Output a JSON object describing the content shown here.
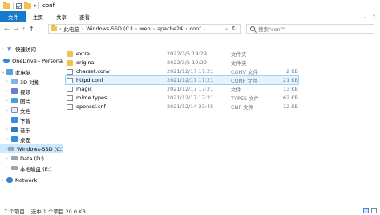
{
  "window": {
    "title": "conf"
  },
  "ribbon": {
    "tabs": [
      "文件",
      "主页",
      "共享",
      "查看"
    ]
  },
  "address": {
    "crumbs": [
      "此电脑",
      "Windows-SSD (C:)",
      "web",
      "apache24",
      "conf"
    ]
  },
  "search": {
    "placeholder": "搜索\"conf\""
  },
  "sidebar": {
    "items": [
      {
        "label": "快速访问",
        "icon": "star-icon"
      },
      {
        "label": "OneDrive - Persona",
        "icon": "cloud-icon"
      },
      {
        "label": "此电脑",
        "icon": "computer-icon"
      },
      {
        "label": "3D 对象",
        "icon": "cube-icon"
      },
      {
        "label": "视频",
        "icon": "video-icon"
      },
      {
        "label": "图片",
        "icon": "picture-icon"
      },
      {
        "label": "文档",
        "icon": "document-icon"
      },
      {
        "label": "下载",
        "icon": "download-icon"
      },
      {
        "label": "音乐",
        "icon": "music-icon"
      },
      {
        "label": "桌面",
        "icon": "desktop-icon"
      },
      {
        "label": "Windows-SSD (C:)",
        "icon": "drive-icon"
      },
      {
        "label": "Data (D:)",
        "icon": "drive-icon"
      },
      {
        "label": "本地磁盘 (E:)",
        "icon": "drive-icon"
      },
      {
        "label": "Network",
        "icon": "network-icon"
      }
    ]
  },
  "files": [
    {
      "name": "extra",
      "date": "2022/3/5 19:29",
      "type": "文件夹",
      "size": "",
      "kind": "folder"
    },
    {
      "name": "original",
      "date": "2022/3/5 19:29",
      "type": "文件夹",
      "size": "",
      "kind": "folder"
    },
    {
      "name": "charset.conv",
      "date": "2021/12/17 17:21",
      "type": "CONV 文件",
      "size": "2 KB",
      "kind": "file"
    },
    {
      "name": "httpd.conf",
      "date": "2021/12/17 17:21",
      "type": "CONF 文件",
      "size": "21 KB",
      "kind": "file"
    },
    {
      "name": "magic",
      "date": "2021/12/17 17:21",
      "type": "文件",
      "size": "13 KB",
      "kind": "file"
    },
    {
      "name": "mime.types",
      "date": "2021/12/17 17:21",
      "type": "TYPES 文件",
      "size": "62 KB",
      "kind": "file"
    },
    {
      "name": "openssl.cnf",
      "date": "2021/12/14 23:45",
      "type": "CNF 文件",
      "size": "12 KB",
      "kind": "file"
    }
  ],
  "status": {
    "count": "7 个项目",
    "selected": "选中 1 个项目  20.0 KB"
  }
}
